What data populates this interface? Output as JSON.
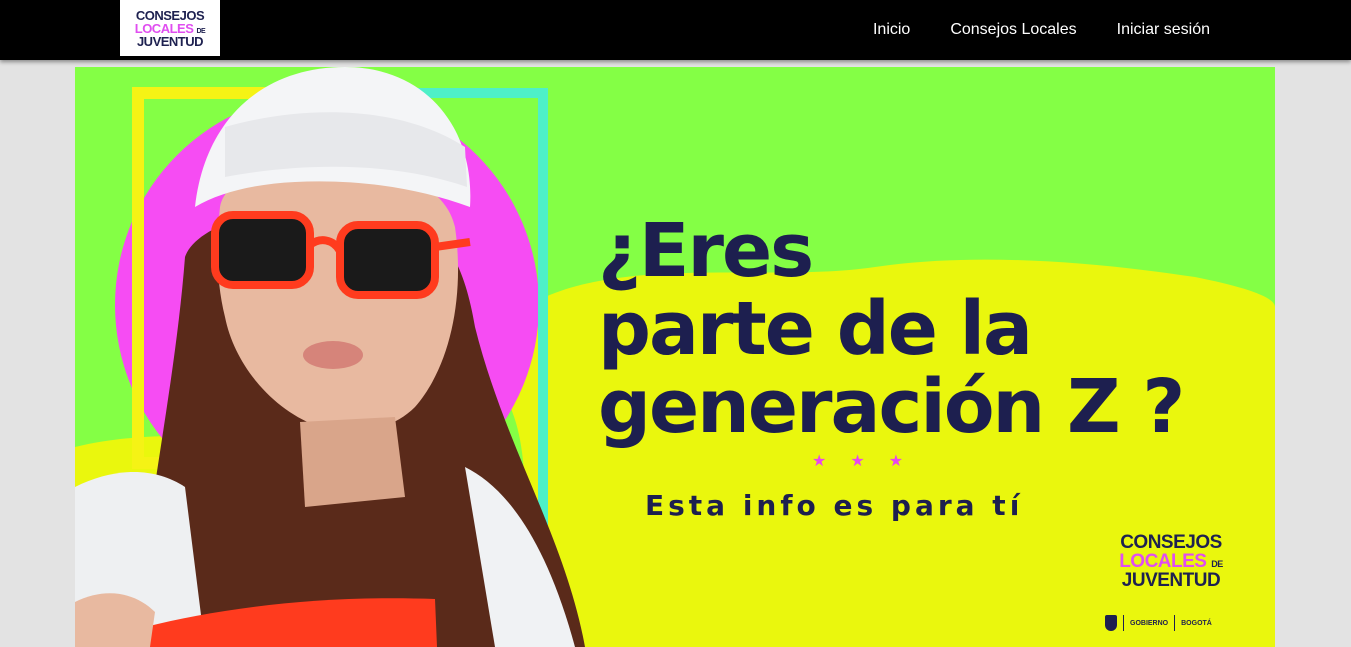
{
  "nav": {
    "logo": {
      "line1": "CONSEJOS",
      "line2": "LOCALES",
      "line2_small": "DE",
      "line3": "JUVENTUD"
    },
    "links": [
      {
        "label": "Inicio"
      },
      {
        "label": "Consejos Locales"
      },
      {
        "label": "Iniciar sesión"
      }
    ]
  },
  "banner": {
    "headline_lines": [
      "¿Eres",
      "parte de la",
      "generación Z ?"
    ],
    "stars": "★★★",
    "subline": "Esta info es para tí",
    "logo": {
      "line1": "CONSEJOS",
      "line2": "LOCALES",
      "line2_small": "DE",
      "line3": "JUVENTUD"
    },
    "sponsors": {
      "secretaria": "GOBIERNO",
      "city": "BOGOTÁ"
    }
  },
  "colors": {
    "nav_bg": "#000000",
    "banner_green": "#84ff45",
    "banner_yellow": "#eaf70d",
    "headline_navy": "#1d1f4f",
    "accent_magenta": "#e946ee",
    "frame_yellow": "#f5f315",
    "frame_cyan": "#4ef0c8"
  }
}
